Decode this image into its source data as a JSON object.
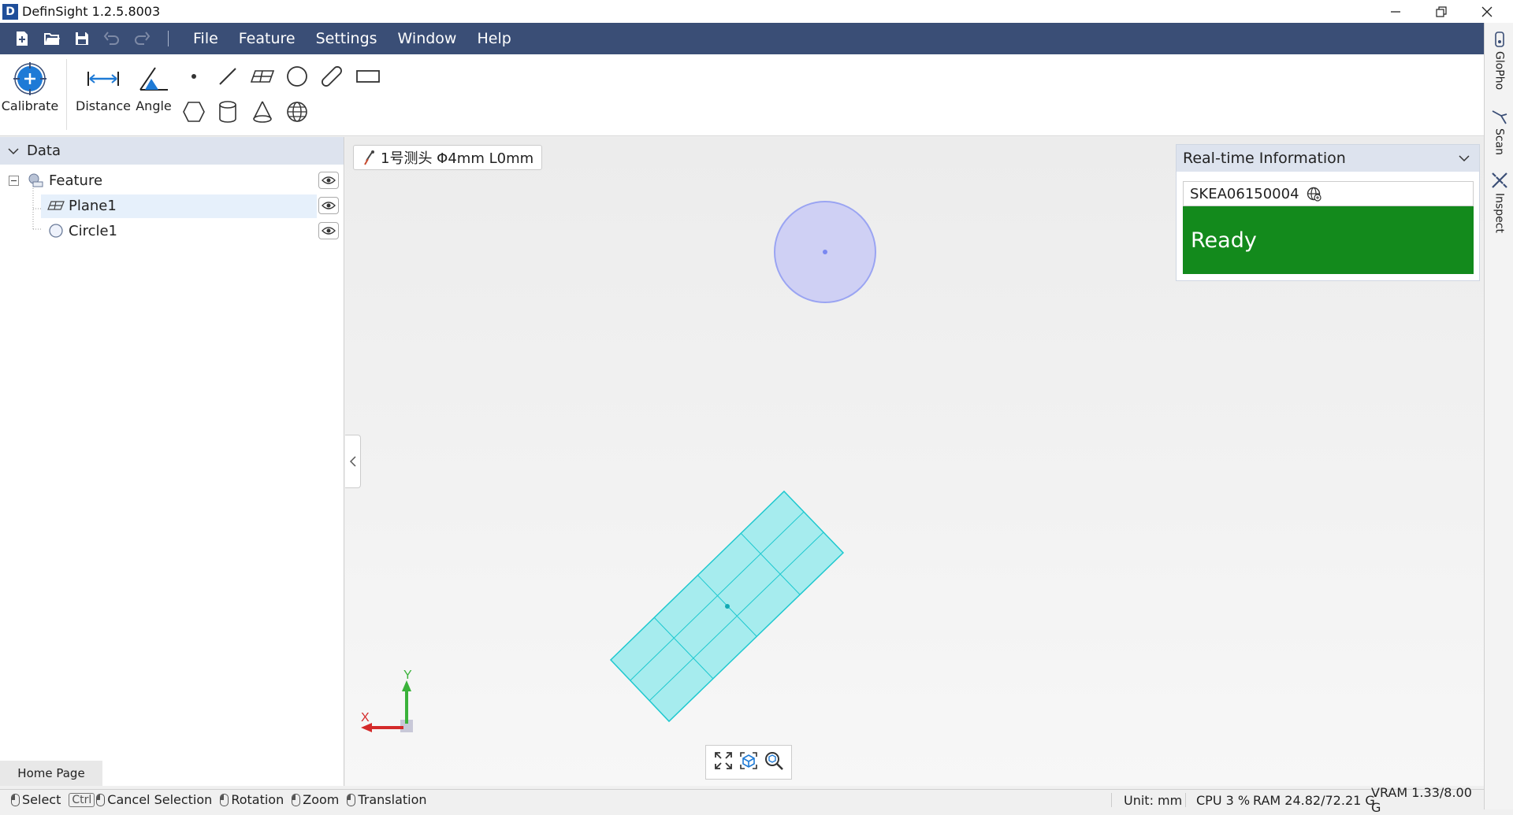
{
  "window": {
    "title": "DefinSight 1.2.5.8003",
    "logo_text": "D"
  },
  "menu": {
    "items": [
      "File",
      "Feature",
      "Settings",
      "Window",
      "Help"
    ]
  },
  "ribbon": {
    "calibrate_label": "Calibrate",
    "distance_label": "Distance",
    "angle_label": "Angle",
    "tools_row1": [
      "point-icon",
      "line-icon",
      "plane-icon",
      "circle-icon",
      "slot-icon",
      "rectangle-icon"
    ],
    "tools_row2": [
      "hexagon-icon",
      "cylinder-icon",
      "cone-icon",
      "sphere-icon"
    ]
  },
  "data_panel": {
    "header": "Data",
    "tree": [
      {
        "label": "Feature",
        "icon": "feature-icon",
        "level": 0
      },
      {
        "label": "Plane1",
        "icon": "plane-icon",
        "level": 1,
        "selected": true
      },
      {
        "label": "Circle1",
        "icon": "circle-icon",
        "level": 1
      }
    ],
    "home_tab": "Home Page"
  },
  "viewport": {
    "probe_label": "1号测头 Φ4mm L0mm",
    "axis_x": "X",
    "axis_y": "Y"
  },
  "realtime": {
    "header": "Real-time Information",
    "serial": "SKEA06150004",
    "status": "Ready",
    "status_color": "#138a1c"
  },
  "right_dock": {
    "items": [
      "GloPho",
      "Scan",
      "Inspect"
    ]
  },
  "status_bar": {
    "select": "Select",
    "ctrl": "Ctrl",
    "cancel_selection": "Cancel Selection",
    "rotation": "Rotation",
    "zoom": "Zoom",
    "translation": "Translation",
    "unit": "Unit: mm",
    "cpu": "CPU 3 %",
    "ram": "RAM 24.82/72.21 G",
    "vram": "VRAM 1.33/8.00 G"
  },
  "colors": {
    "menubar": "#3a4e76",
    "accent": "#1e7ad6",
    "plane_fill": "#a6ecee",
    "plane_edge": "#1ec8cf",
    "circle_fill": "#cfd0f4",
    "circle_edge": "#9aa4f2"
  }
}
